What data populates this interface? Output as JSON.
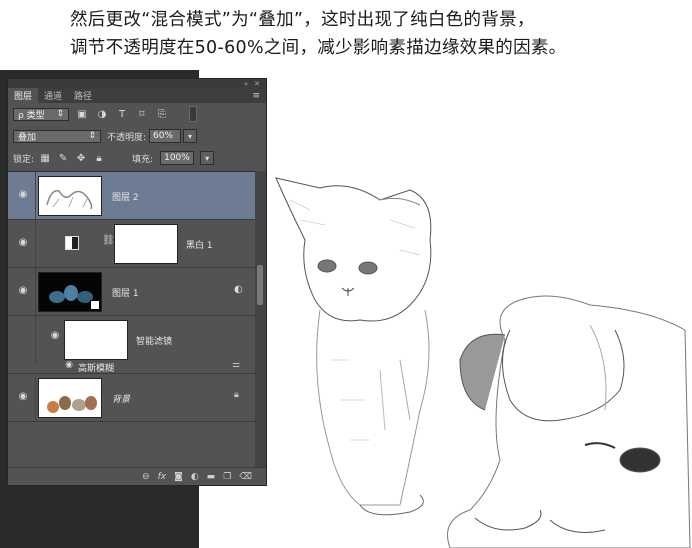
{
  "caption": {
    "line1": "然后更改“混合模式”为“叠加”，这时出现了纯白色的背景，",
    "line2": "调节不透明度在50-60%之间，减少影响素描边缘效果的因素。"
  },
  "panel": {
    "tabs": [
      {
        "label": "图层",
        "active": true
      },
      {
        "label": "通道",
        "active": false
      },
      {
        "label": "路径",
        "active": false
      }
    ],
    "filter": {
      "label": "ρ 类型",
      "icons": [
        "image-filter-icon",
        "adjustment-filter-icon",
        "type-filter-icon",
        "shape-filter-icon",
        "smart-object-filter-icon"
      ]
    },
    "blend_mode": "叠加",
    "opacity_label": "不透明度:",
    "opacity_value": "60%",
    "lock_label": "锁定:",
    "fill_label": "填充:",
    "fill_value": "100%"
  },
  "layers": [
    {
      "name": "图层 2",
      "selected": true
    },
    {
      "name": "黑白 1",
      "selected": false
    },
    {
      "name": "图层 1",
      "selected": false
    },
    {
      "name": "智能滤镜",
      "selected": false
    },
    {
      "name": "高斯模糊",
      "selected": false
    },
    {
      "name": "背景",
      "selected": false
    }
  ],
  "bottom_icons": [
    "link-icon",
    "fx-icon",
    "mask-icon",
    "adjustment-icon",
    "folder-icon",
    "new-layer-icon",
    "trash-icon"
  ],
  "colors": {
    "panel": "#535353",
    "selected_layer": "#6d7c92",
    "dark_background": "#2a2a2a"
  }
}
